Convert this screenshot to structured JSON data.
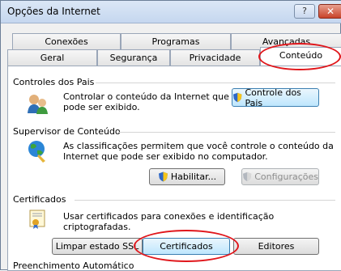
{
  "window": {
    "title": "Opções da Internet",
    "help_glyph": "?",
    "close_glyph": "✕"
  },
  "tabs_back": [
    "Conexões",
    "Programas",
    "Avançadas"
  ],
  "tabs_front": [
    "Geral",
    "Segurança",
    "Privacidade",
    "Conteúdo"
  ],
  "active_tab": "Conteúdo",
  "parental": {
    "title": "Controles dos Pais",
    "text_line1": "Controlar o conteúdo da Internet que",
    "text_line2": "pode ser exibido.",
    "button": "Controle dos Pais"
  },
  "supervisor": {
    "title": "Supervisor de Conteúdo",
    "text_line1": "As classificações permitem que você controle o conteúdo da",
    "text_line2": "Internet que pode ser exibido no computador.",
    "enable_button": "Habilitar...",
    "settings_button": "Configurações"
  },
  "certificates": {
    "title": "Certificados",
    "text": "Usar certificados para conexões e identificação criptografadas.",
    "clear_ssl_button": "Limpar estado SSL",
    "certificates_button": "Certificados",
    "publishers_button": "Editores"
  },
  "autocomplete": {
    "title": "Preenchimento Automático"
  },
  "colors": {
    "annotation": "#e0161b"
  }
}
